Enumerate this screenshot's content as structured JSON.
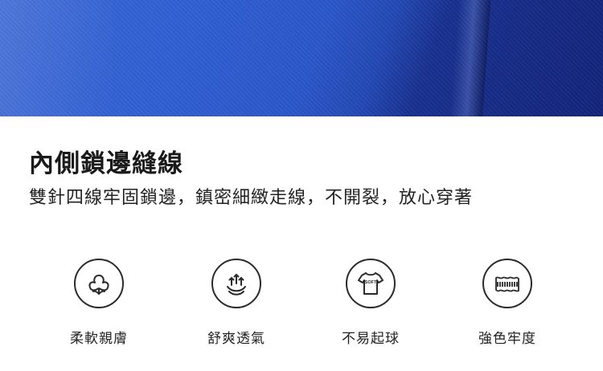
{
  "banner": {
    "title": "內側鎖邊縫線",
    "subtitle": "雙針四線牢固鎖邊，鎮密細緻走線，不開裂，放心穿著"
  },
  "features": [
    {
      "label": "柔軟親膚",
      "icon": "cotton-flower-icon"
    },
    {
      "label": "舒爽透氣",
      "icon": "breathable-arrows-icon"
    },
    {
      "label": "不易起球",
      "icon": "soft-tshirt-icon",
      "icon_text": "SOFT"
    },
    {
      "label": "強色牢度",
      "icon": "fabric-wave-icon"
    }
  ],
  "colors": {
    "fabric_blue": "#2f5fd3",
    "text": "#1a1a1a"
  }
}
